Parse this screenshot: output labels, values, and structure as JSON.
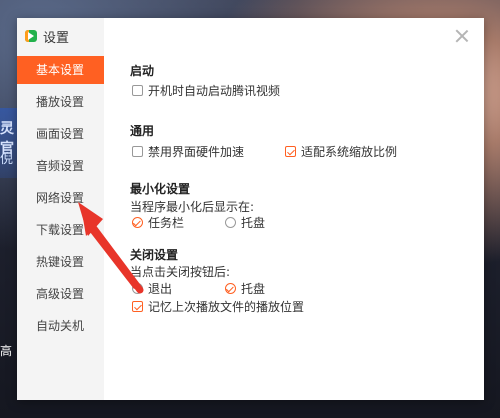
{
  "window": {
    "title": "设置",
    "close_icon": "close-icon"
  },
  "sidebar": {
    "items": [
      {
        "label": "基本设置",
        "active": true
      },
      {
        "label": "播放设置"
      },
      {
        "label": "画面设置"
      },
      {
        "label": "音频设置"
      },
      {
        "label": "网络设置"
      },
      {
        "label": "下载设置"
      },
      {
        "label": "热键设置"
      },
      {
        "label": "高级设置"
      },
      {
        "label": "自动关机"
      }
    ]
  },
  "main": {
    "startup": {
      "title": "启动",
      "autostart": {
        "label": "开机时自动启动腾讯视频",
        "checked": false
      }
    },
    "general": {
      "title": "通用",
      "hw_accel": {
        "label": "禁用界面硬件加速",
        "checked": false
      },
      "dpi_scale": {
        "label": "适配系统缩放比例",
        "checked": true
      }
    },
    "minimize": {
      "title": "最小化设置",
      "prompt": "当程序最小化后显示在:",
      "options": [
        {
          "label": "任务栏",
          "checked": true
        },
        {
          "label": "托盘",
          "checked": false
        }
      ]
    },
    "close": {
      "title": "关闭设置",
      "prompt": "当点击关闭按钮后:",
      "options": [
        {
          "label": "退出",
          "checked": false
        },
        {
          "label": "托盘",
          "checked": true
        }
      ],
      "remember_pos": {
        "label": "记忆上次播放文件的播放位置",
        "checked": true
      }
    }
  },
  "background": {
    "text1": "灵官",
    "text2": "倪",
    "text3": "高"
  },
  "colors": {
    "accent": "#ff6022",
    "annotation_arrow": "#e8352a"
  }
}
